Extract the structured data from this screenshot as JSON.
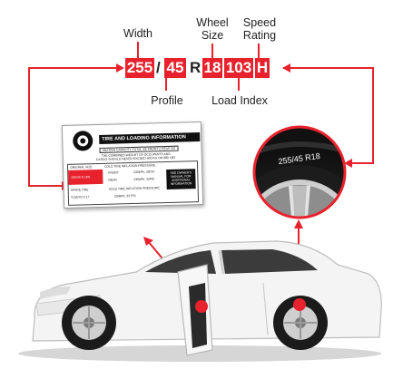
{
  "labels": {
    "width": "Width",
    "wheel_size": [
      "Wheel",
      "Size"
    ],
    "speed_rating": [
      "Speed",
      "Rating"
    ],
    "profile": "Profile",
    "load_index": "Load Index"
  },
  "tire_code": {
    "width": "255",
    "slash": "/",
    "profile": "45",
    "construction": "R",
    "wheel_size": "18",
    "load_index": "103",
    "speed_rating": "H"
  },
  "placard": {
    "title": "TIRE AND LOADING INFORMATION",
    "seating_row": "SEATING CAPACITY   TOTAL 4/5   FRONT 2   REAR 3/5",
    "weight_note_1": "THE COMBINED WEIGHT OF OCCUPANTS AND",
    "weight_note_2": "CARGO SHOULD NEVER EXCEED 400 KG OR 880 LBS",
    "col_original": "ORIGINAL SIZE",
    "col_pressure": "COLD TIRE INFLATION PRESSURE",
    "highlight_size": "255/45 R 18H",
    "front": "FRONT",
    "front_value": "230kPA, 33PSI",
    "rear": "REAR",
    "rear_value": "230kPA, 33PSI",
    "spare": "SPARE TIRE",
    "spare_pressure": "COLD TIRE INFLATION PRESSURE",
    "spare_size": "T155/70 D 17",
    "spare_value": "230kPA, 33 PSI",
    "see_manual": "SEE OWNER'S MANUAL FOR ADDITIONAL INFORMATION"
  },
  "sidewall_text": "255/45 R18",
  "colors": {
    "accent": "#e8222d",
    "text": "#222222"
  }
}
